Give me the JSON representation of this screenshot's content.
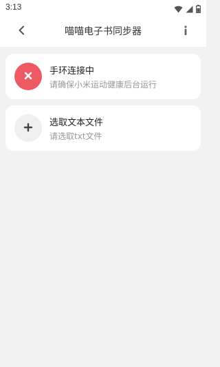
{
  "status_bar": {
    "time": "3:13",
    "icons": [
      "wifi-icon",
      "signal-icon",
      "battery-icon"
    ]
  },
  "app_bar": {
    "title": "喵喵电子书同步器",
    "back_icon": "chevron-left-icon",
    "info_icon": "info-icon"
  },
  "cards": {
    "status": {
      "icon": "close-icon",
      "title": "手环连接中",
      "subtitle": "请确保小米运动健康后台运行"
    },
    "file": {
      "icon": "plus-icon",
      "title": "选取文本文件",
      "subtitle": "请选取txt文件"
    }
  },
  "colors": {
    "error": "#ee5a63",
    "background": "#f2f2f2",
    "card": "#ffffff",
    "subtitle": "#999999"
  }
}
